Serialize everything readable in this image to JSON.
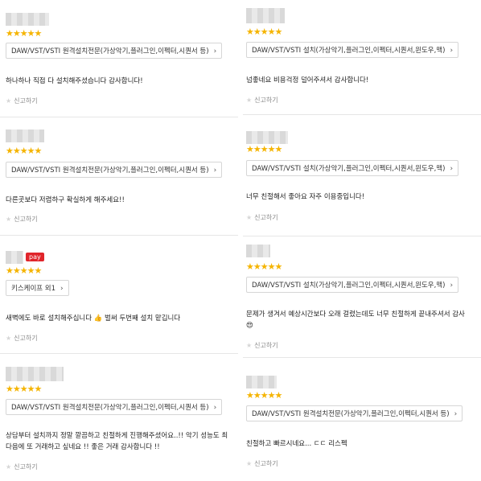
{
  "rating_stars": "★★★★★",
  "chevron": "›",
  "report_label": "신고하기",
  "left": [
    {
      "option": "DAW/VST/VSTI 원격설치전문(가상악기,플러그인,이펙터,시퀀서 등)",
      "lines": [
        "하나하나 직접 다 설치해주셨습니다 감사합니다!"
      ]
    },
    {
      "option": "DAW/VST/VSTI 원격설치전문(가상악기,플러그인,이펙터,시퀀서 등)",
      "lines": [
        "다른곳보다 저렴하구 확실하게 해주세요!!"
      ]
    },
    {
      "pay_badge": "pay",
      "option": "키스케이프 외1",
      "lines": [
        "새벽에도 바로 설치해주십니다 👍 벌써 두번째 설치 맡깁니다"
      ]
    },
    {
      "option": "DAW/VST/VSTI 원격설치전문(가상악기,플러그인,이펙터,시퀀서 등)",
      "lines": [
        "상담부터 설치까지 정말 깔끔하고 친절하게 진행해주셨어요..!! 악기 성능도 최",
        "다음에 또 거래하고 싶네요 !! 좋은 거래 감사합니다 !!"
      ]
    }
  ],
  "right": [
    {
      "option": "DAW/VST/VSTI 설치(가상악기,플러그인,이펙터,시퀀서,윈도우,맥)",
      "lines": [
        "넘좋네요 비용걱정 덜어주셔서 감사합니다!"
      ]
    },
    {
      "option": "DAW/VST/VSTI 설치(가상악기,플러그인,이펙터,시퀀서,윈도우,맥)",
      "lines": [
        "너무 친절해서 좋아요 자주 이용중입니다!"
      ]
    },
    {
      "option": "DAW/VST/VSTI 설치(가상악기,플러그인,이펙터,시퀀서,윈도우,맥)",
      "lines": [
        "문제가 생겨서 예상시간보다 오래 걸렸는데도 너무 친절하게 끝내주셔서 감사",
        "😍"
      ]
    },
    {
      "option": "DAW/VST/VSTI 원격설치전문(가상악기,플러그인,이펙터,시퀀서 등)",
      "lines": [
        "친절하고 빠르시네요... ㄷㄷ 리스펙"
      ]
    }
  ]
}
